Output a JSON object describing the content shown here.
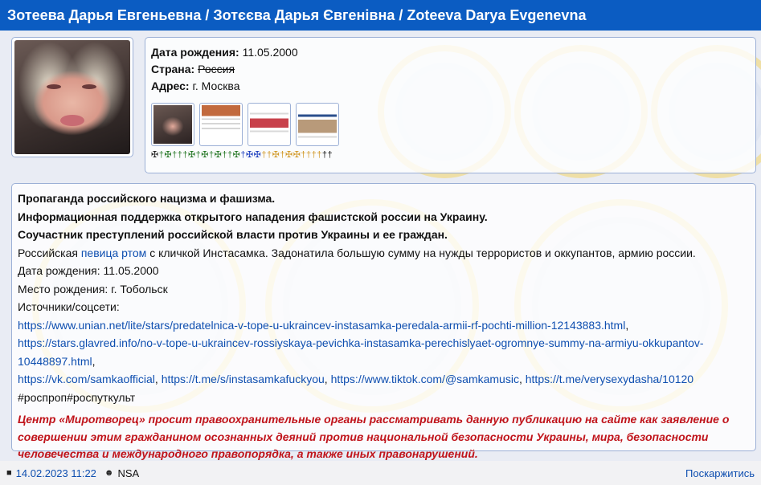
{
  "header": {
    "title": "Зотеева Дарья Евгеньевна / Зотєєва Дарья Євгенівна / Zoteeva Darya Evgenevna"
  },
  "profile": {
    "birth_label": "Дата рождения:",
    "birth_value": "11.05.2000",
    "country_label": "Страна:",
    "country_value": "Россия",
    "address_label": "Адрес:",
    "address_value": "г. Москва",
    "thumbnails": [
      "photo",
      "article-1",
      "article-2",
      "article-3"
    ],
    "crosses_glyphs": [
      "✠",
      "†",
      "✠",
      "†",
      "†",
      "†",
      "✠",
      "†",
      "✠",
      "†",
      "✠",
      "†",
      "†",
      "✠",
      "†",
      "✠",
      "✠",
      "†",
      "†",
      "✠",
      "†",
      "✠",
      "✠",
      "†",
      "†",
      "†",
      "†",
      "†",
      "†"
    ],
    "crosses_colors": [
      "#222",
      "#2a7a2a",
      "#2a7a2a",
      "#2a7a2a",
      "#2a7a2a",
      "#2a7a2a",
      "#2a7a2a",
      "#2a7a2a",
      "#2a7a2a",
      "#2a7a2a",
      "#2a7a2a",
      "#2a7a2a",
      "#2a7a2a",
      "#2a7a2a",
      "#1d3fbf",
      "#1d3fbf",
      "#1d3fbf",
      "#d29a2a",
      "#d29a2a",
      "#d29a2a",
      "#d29a2a",
      "#d29a2a",
      "#d29a2a",
      "#d29a2a",
      "#d29a2a",
      "#d29a2a",
      "#d29a2a",
      "#111",
      "#111"
    ]
  },
  "description": {
    "line1": "Пропаганда российского нацизма и фашизма.",
    "line2": "Информационная поддержка открытого нападения фашистской россии на Украину.",
    "line3": "Соучастник преступлений российской власти против Украины и ее граждан.",
    "bio_prefix": "Российская ",
    "bio_link": "певица ртом",
    "bio_suffix": " с кличкой Инстасамка. Задонатила большую сумму на нужды террористов и оккупантов, армию россии.",
    "birth_line": "Дата рождения: 11.05.2000",
    "birthplace_line": "Место рождения: г. Тобольск",
    "sources_label": "Источники/соцсети:",
    "source1": "https://www.unian.net/lite/stars/predatelnica-v-tope-u-ukraincev-instasamka-peredala-armii-rf-pochti-million-12143883.html",
    "source2a": "https://stars.glavred.info/no-v-tope-u-ukraincev-rossiyskaya-pevichka-instasamka-perechislyaet-ogromnye-summy-na-armiyu-okkupantov-",
    "source2b": "10448897.html",
    "vk": "https://vk.com/samkaofficial",
    "tg1": "https://t.me/s/instasamkafuckyou",
    "tiktok": "https://www.tiktok.com/@samkamusic",
    "tg2": "https://t.me/verysexydasha/10120",
    "tags": "#роспроп#роспуткульт",
    "appeal": "Центр «Миротворец» просит правоохранительные органы рассматривать данную публикацию на сайте как заявление о совершении этим гражданином осознанных деяний против национальной безопасности Украины, мира, безопасности человечества и международного правопорядка, а также иных правонарушений."
  },
  "footer": {
    "date": "14.02.2023 11:22",
    "author": "NSA",
    "complain": "Поскаржитись"
  },
  "colors": {
    "header": "#0b5cc2",
    "link": "#0f4fb0",
    "appeal": "#c0141b"
  }
}
